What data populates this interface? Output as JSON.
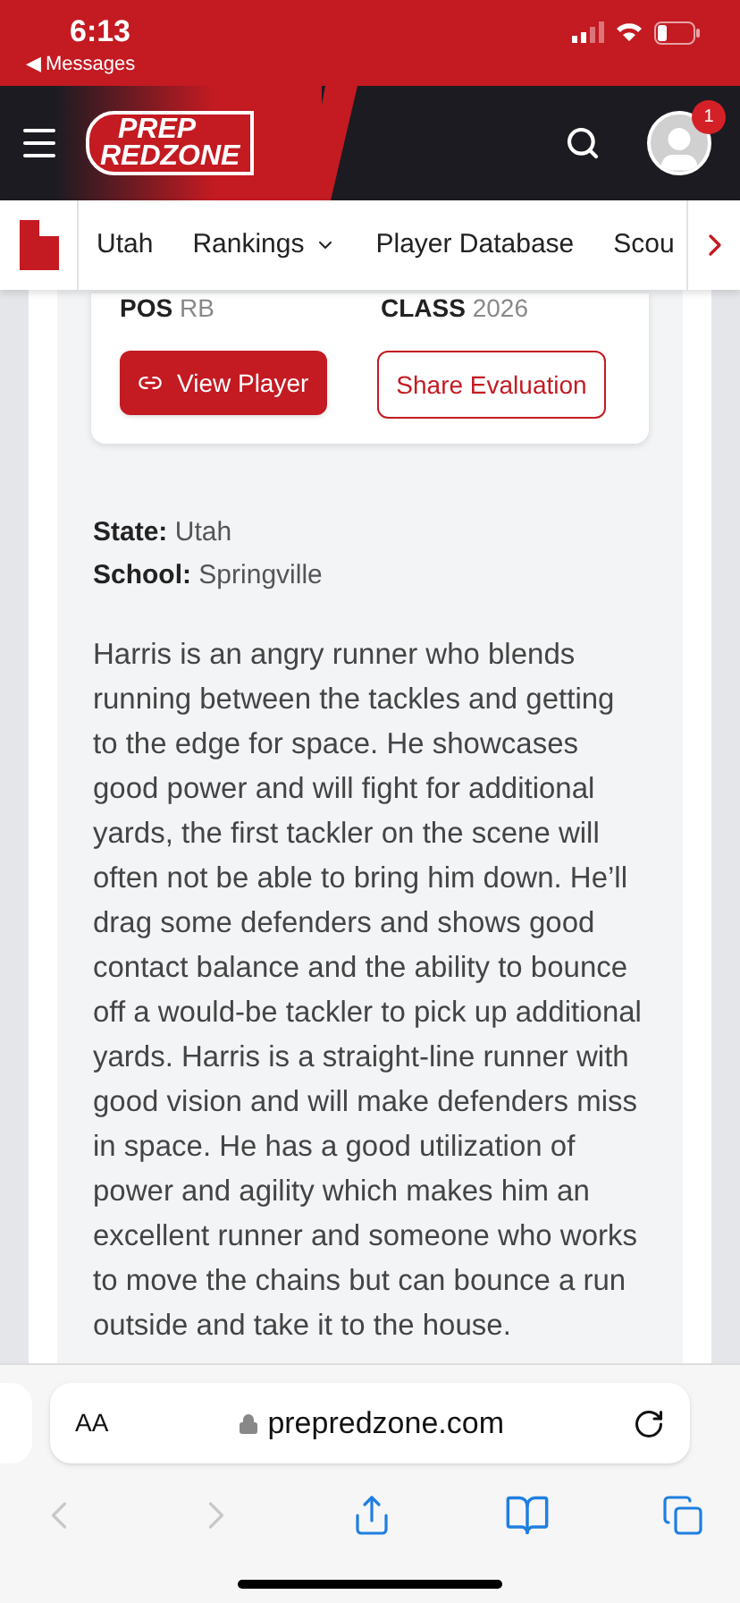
{
  "status_bar": {
    "time": "6:13",
    "back_label": "◀ Messages"
  },
  "header": {
    "logo_top": "PREP",
    "logo_bottom": "REDZONE",
    "notification_count": "1"
  },
  "nav": {
    "items": [
      {
        "label": "Utah",
        "dropdown": false
      },
      {
        "label": "Rankings",
        "dropdown": true
      },
      {
        "label": "Player Database",
        "dropdown": false
      },
      {
        "label": "Scou",
        "dropdown": false
      }
    ]
  },
  "player_card": {
    "fields": [
      {
        "label": "POS",
        "value": "RB"
      },
      {
        "label": "CLASS",
        "value": "2026"
      }
    ],
    "buttons": [
      {
        "label": "View Player",
        "kind": "primary"
      },
      {
        "label": "Share Evaluation",
        "kind": "outline"
      }
    ]
  },
  "info": [
    {
      "label": "State:",
      "value": "Utah"
    },
    {
      "label": "School:",
      "value": "Springville"
    }
  ],
  "evaluation": "Harris is an angry runner who blends running between the tackles and getting to the edge for space. He showcases good power and will fight for additional yards, the first tackler on the scene will often not be able to bring him down. He’ll drag some defenders and shows good contact balance and the ability to bounce off a would-be tackler to pick up additional yards. Harris is a straight-line runner with good vision and will make defenders miss in space. He has a good utilization of power and agility which makes him an excellent runner and someone who works to move the chains but can bounce a run outside and take it to the house.",
  "browser": {
    "text_size": "AA",
    "url": "prepredzone.com"
  }
}
